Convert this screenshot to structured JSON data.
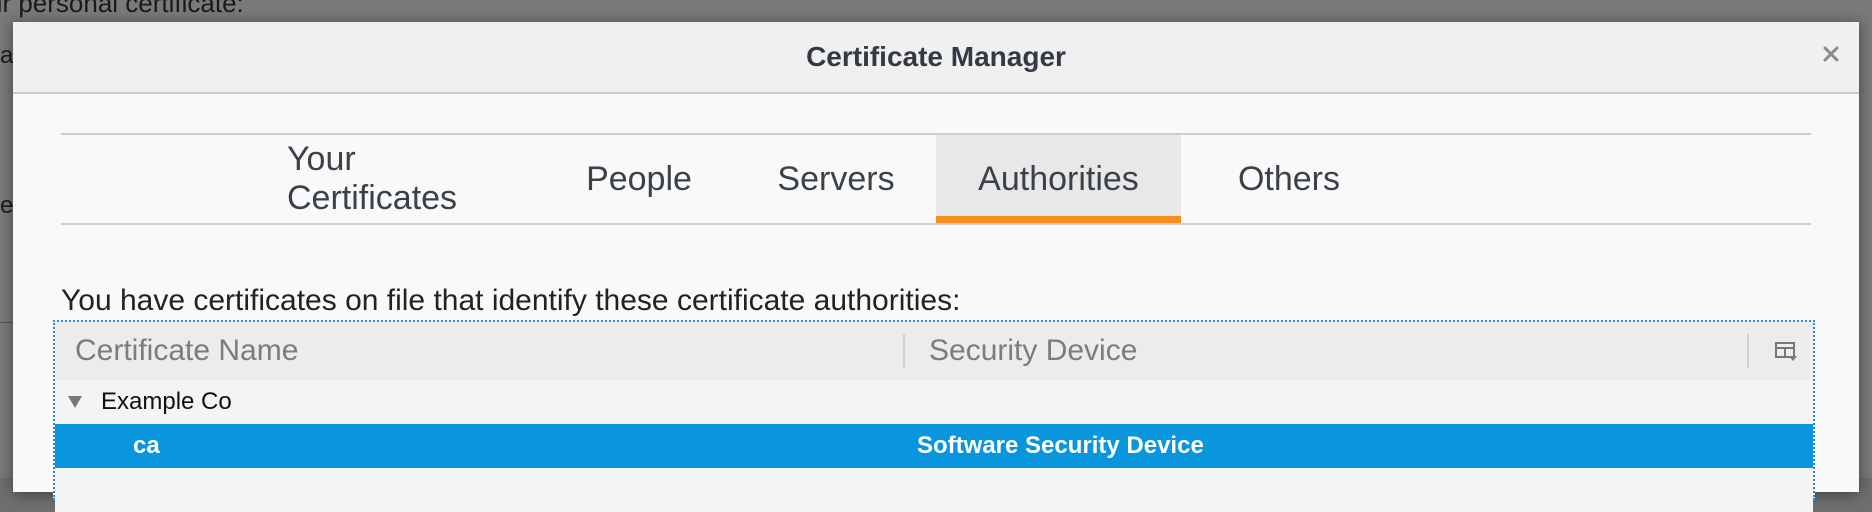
{
  "background": {
    "partial_text": "ur personal certificate:",
    "frag_1": "al",
    "frag_2": "er"
  },
  "dialog": {
    "title": "Certificate Manager",
    "close_icon": "close-icon"
  },
  "tabs": [
    {
      "label": "Your Certificates",
      "selected": false
    },
    {
      "label": "People",
      "selected": false
    },
    {
      "label": "Servers",
      "selected": false
    },
    {
      "label": "Authorities",
      "selected": true
    },
    {
      "label": "Others",
      "selected": false
    }
  ],
  "description": "You have certificates on file that identify these certificate authorities:",
  "tree": {
    "columns": [
      "Certificate Name",
      "Security Device"
    ],
    "column_picker_icon": "column-picker-icon",
    "group": {
      "label": "Example Co",
      "expanded": true
    },
    "rows": [
      {
        "name": "ca",
        "device": "Software Security Device",
        "selected": true
      }
    ]
  },
  "colors": {
    "accent_tab": "#f68f1e",
    "selection": "#0a96dc",
    "focus_border": "#2a8fd0"
  }
}
